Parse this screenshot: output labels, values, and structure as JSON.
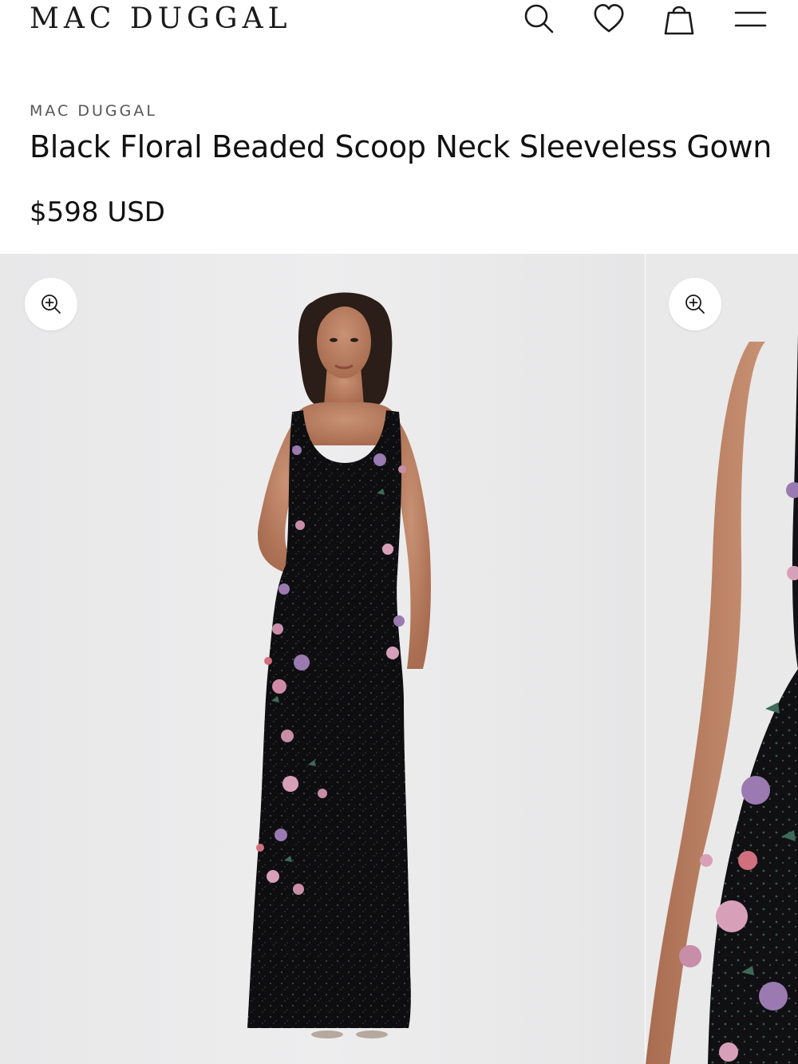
{
  "header": {
    "logo": "MAC DUGGAL",
    "icons": [
      "search-icon",
      "heart-icon",
      "shopping-bag-icon",
      "menu-icon"
    ]
  },
  "product": {
    "brand": "MAC DUGGAL",
    "title": "Black Floral Beaded Scoop Neck Sleeveless Gown",
    "price": "$598 USD"
  },
  "gallery": {
    "images": [
      {
        "alt": "Model wearing black floral beaded gown, front view"
      },
      {
        "alt": "Close-up of floral beading detail"
      }
    ],
    "zoom_icon": "zoom-in-icon"
  },
  "colors": {
    "text": "#1a1a1a",
    "gown": "#111111",
    "background": "#ebebec"
  }
}
